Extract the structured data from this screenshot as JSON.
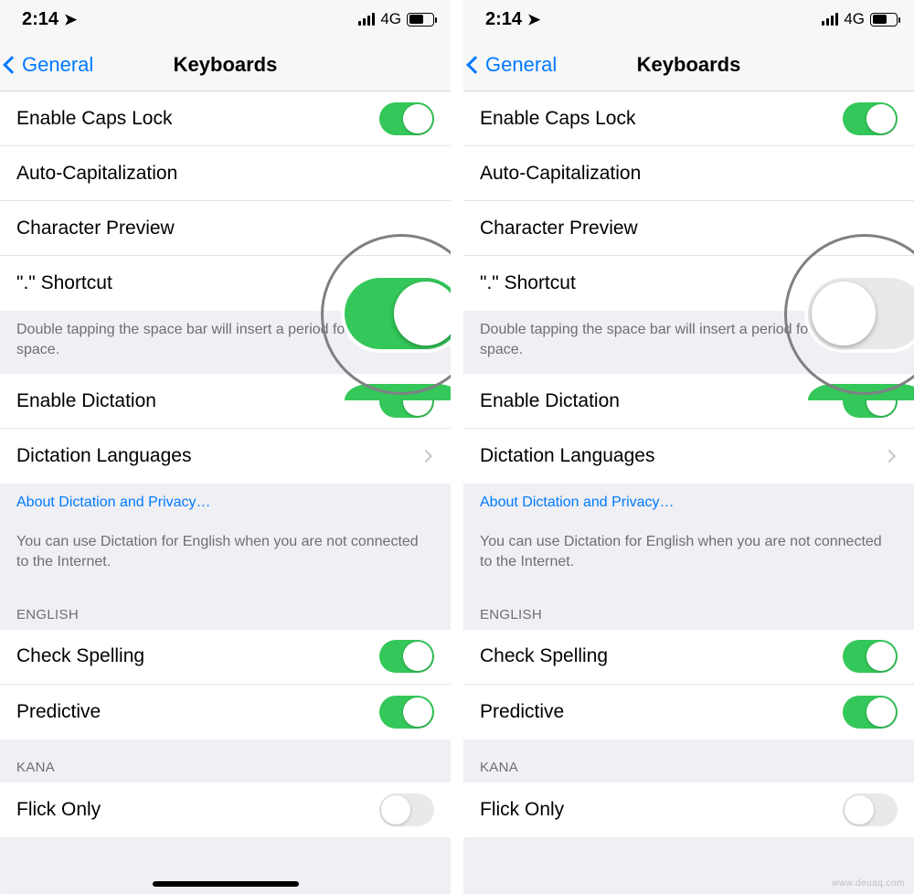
{
  "leftPhone": {
    "charPreviewOn": true
  },
  "rightPhone": {
    "charPreviewOn": false
  },
  "status": {
    "time": "2:14",
    "network": "4G"
  },
  "nav": {
    "back": "General",
    "title": "Keyboards"
  },
  "rows": {
    "capsLock": "Enable Caps Lock",
    "autoCap": "Auto-Capitalization",
    "charPreview": "Character Preview",
    "dotShortcut": "\".\" Shortcut",
    "enableDictation": "Enable Dictation",
    "dictationLang": "Dictation Languages",
    "checkSpelling": "Check Spelling",
    "predictive": "Predictive",
    "flickOnly": "Flick Only"
  },
  "footers": {
    "spacebar": "Double tapping the space bar will insert a period followed by a space.",
    "aboutDictation": "About Dictation and Privacy…",
    "dictationOffline": "You can use Dictation for English when you are not connected to the Internet."
  },
  "sectionHeaders": {
    "english": "ENGLISH",
    "kana": "KANA"
  },
  "toggles": {
    "capsLock": true,
    "autoCap": true,
    "dotShortcut": true,
    "enableDictation": true,
    "checkSpelling": true,
    "predictive": true,
    "flickOnly": false
  },
  "watermark": "www.deuaq.com"
}
